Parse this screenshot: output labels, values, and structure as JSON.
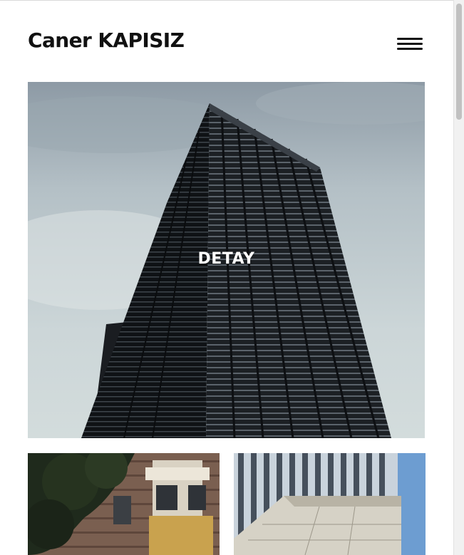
{
  "header": {
    "brand": "Caner KAPISIZ",
    "menu_icon": "hamburger-menu-icon"
  },
  "hero": {
    "overlay_label": "DETAY",
    "image": "skyscraper-photo"
  },
  "gallery": {
    "items": [
      {
        "image": "brick-apartment-balconies-photo"
      },
      {
        "image": "glass-office-building-photo"
      }
    ]
  },
  "colors": {
    "text": "#111111",
    "overlay_text": "#ffffff",
    "background": "#ffffff"
  }
}
